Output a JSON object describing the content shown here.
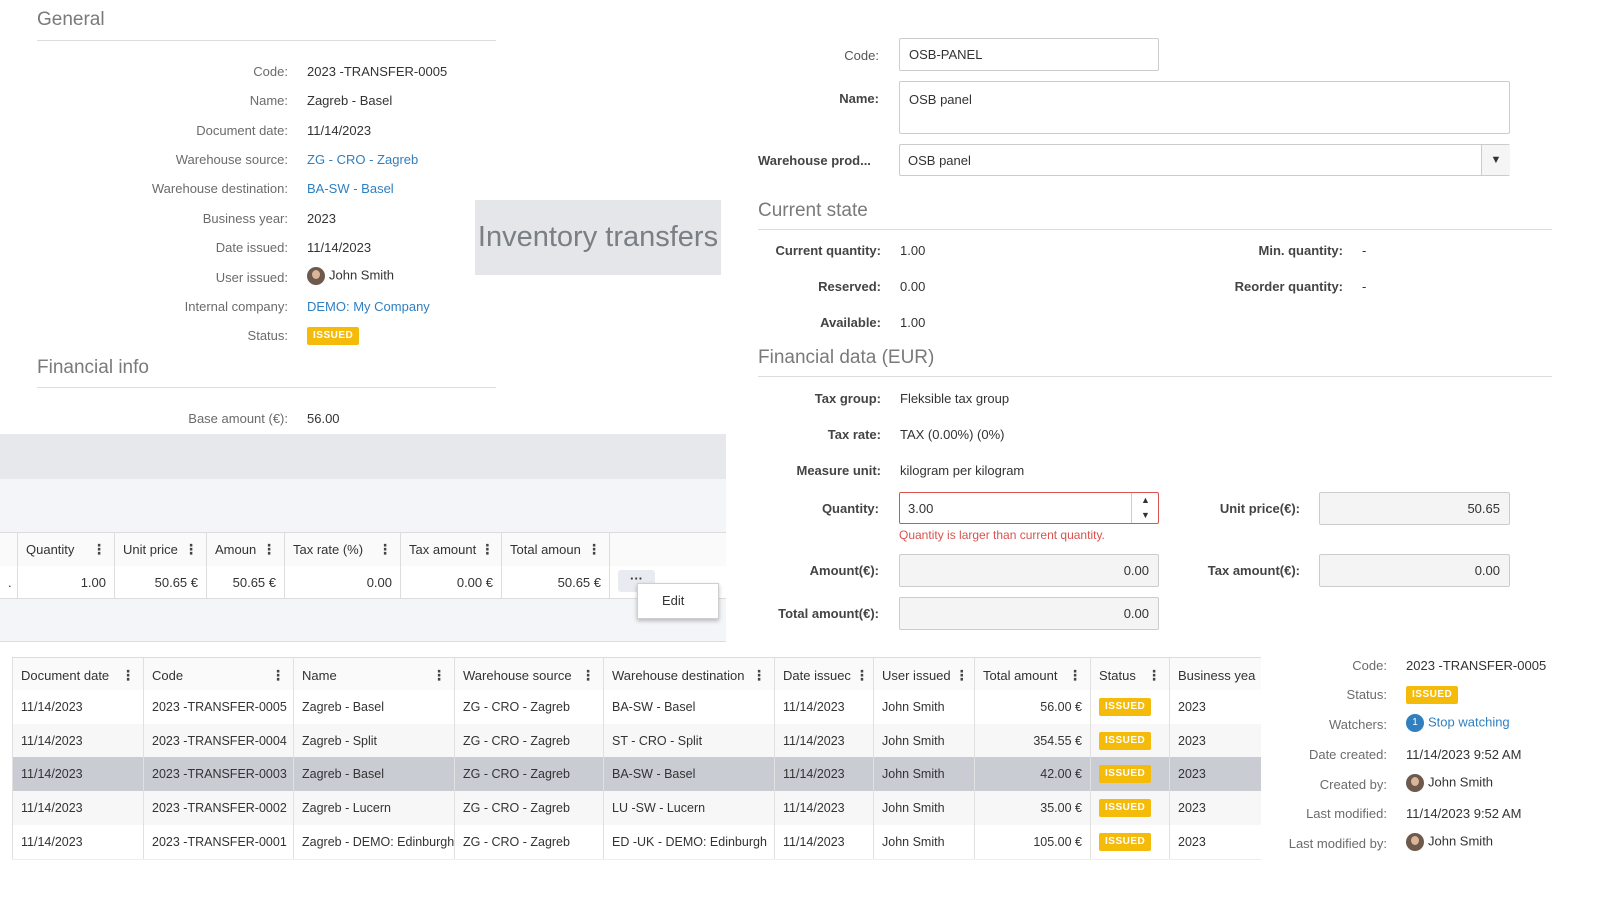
{
  "general": {
    "title": "General",
    "fields": [
      {
        "label": "Code:",
        "value": "2023 -TRANSFER-0005"
      },
      {
        "label": "Name:",
        "value": "Zagreb - Basel"
      },
      {
        "label": "Document date:",
        "value": "11/14/2023"
      },
      {
        "label": "Warehouse source:",
        "value": "ZG - CRO - Zagreb"
      },
      {
        "label": "Warehouse destination:",
        "value": "BA-SW - Basel"
      },
      {
        "label": "Business year:",
        "value": "2023"
      },
      {
        "label": "Date issued:",
        "value": "11/14/2023"
      },
      {
        "label": "User issued:",
        "value": "John Smith"
      },
      {
        "label": "Internal company:",
        "value": "DEMO: My Company"
      },
      {
        "label": "Status:",
        "value": "ISSUED"
      }
    ]
  },
  "financial_info": {
    "title": "Financial info",
    "base_amount_label": "Base amount (€):",
    "base_amount_value": "56.00"
  },
  "overlay_title": "Inventory transfers",
  "item_form": {
    "code_label": "Code:",
    "code_value": "OSB-PANEL",
    "name_label": "Name:",
    "name_value": "OSB panel",
    "warehouse_product_label": "Warehouse prod...",
    "warehouse_product_value": "OSB panel",
    "current_state_title": "Current state",
    "current_quantity_label": "Current quantity:",
    "current_quantity_value": "1.00",
    "reserved_label": "Reserved:",
    "reserved_value": "0.00",
    "available_label": "Available:",
    "available_value": "1.00",
    "min_quantity_label": "Min. quantity:",
    "min_quantity_value": "-",
    "reorder_quantity_label": "Reorder quantity:",
    "reorder_quantity_value": "-",
    "financial_data_title": "Financial data (EUR)",
    "tax_group_label": "Tax group:",
    "tax_group_value": "Fleksible tax group",
    "tax_rate_label": "Tax rate:",
    "tax_rate_value": "TAX (0.00%) (0%)",
    "measure_unit_label": "Measure unit:",
    "measure_unit_value": "kilogram per kilogram",
    "quantity_label": "Quantity:",
    "quantity_value": "3.00",
    "quantity_error": "Quantity is larger than current quantity.",
    "unit_price_label": "Unit price(€):",
    "unit_price_value": "50.65",
    "amount_label": "Amount(€):",
    "amount_value": "0.00",
    "tax_amount_label": "Tax amount(€):",
    "tax_amount_value": "0.00",
    "total_amount_label": "Total amount(€):",
    "total_amount_value": "0.00"
  },
  "items_grid": {
    "headers": [
      "Quantity",
      "Unit price",
      "Amoun",
      "Tax rate (%)",
      "Tax amount",
      "Total amoun"
    ],
    "row": [
      "1.00",
      "50.65 €",
      "50.65 €",
      "0.00",
      "0.00 €",
      "50.65 €"
    ],
    "row_first_cell": ".",
    "menu_button": "···",
    "menu_edit": "Edit"
  },
  "transfers_grid": {
    "headers": [
      "Document date",
      "Code",
      "Name",
      "Warehouse source",
      "Warehouse destination",
      "Date issuec",
      "User issued",
      "Total amount",
      "Status",
      "Business yea"
    ],
    "rows": [
      [
        "11/14/2023",
        "2023 -TRANSFER-0005",
        "Zagreb - Basel",
        "ZG - CRO - Zagreb",
        "BA-SW - Basel",
        "11/14/2023",
        "John Smith",
        "56.00 €",
        "ISSUED",
        "2023"
      ],
      [
        "11/14/2023",
        "2023 -TRANSFER-0004",
        "Zagreb - Split",
        "ZG - CRO - Zagreb",
        "ST - CRO - Split",
        "11/14/2023",
        "John Smith",
        "354.55 €",
        "ISSUED",
        "2023"
      ],
      [
        "11/14/2023",
        "2023 -TRANSFER-0003",
        "Zagreb - Basel",
        "ZG - CRO - Zagreb",
        "BA-SW - Basel",
        "11/14/2023",
        "John Smith",
        "42.00 €",
        "ISSUED",
        "2023"
      ],
      [
        "11/14/2023",
        "2023 -TRANSFER-0002",
        "Zagreb - Lucern",
        "ZG - CRO - Zagreb",
        "LU -SW - Lucern",
        "11/14/2023",
        "John Smith",
        "35.00 €",
        "ISSUED",
        "2023"
      ],
      [
        "11/14/2023",
        "2023 -TRANSFER-0001",
        "Zagreb - DEMO: Edinburgh",
        "ZG - CRO - Zagreb",
        "ED -UK - DEMO: Edinburgh",
        "11/14/2023",
        "John Smith",
        "105.00 €",
        "ISSUED",
        "2023"
      ]
    ],
    "selected_row": 2
  },
  "details_panel": {
    "code_label": "Code:",
    "code_value": "2023 -TRANSFER-0005",
    "status_label": "Status:",
    "status_value": "ISSUED",
    "watchers_label": "Watchers:",
    "watchers_count": "1",
    "watchers_link": "Stop watching",
    "date_created_label": "Date created:",
    "date_created_value": "11/14/2023 9:52 AM",
    "created_by_label": "Created by:",
    "created_by_value": "John Smith",
    "last_modified_label": "Last modified:",
    "last_modified_value": "11/14/2023 9:52 AM",
    "last_modified_by_label": "Last modified by:",
    "last_modified_by_value": "John Smith"
  },
  "colors": {
    "link": "#2f7fc1",
    "badge": "#f5bb0b",
    "error": "#d9534f",
    "selected_row": "#c9ccd3"
  }
}
